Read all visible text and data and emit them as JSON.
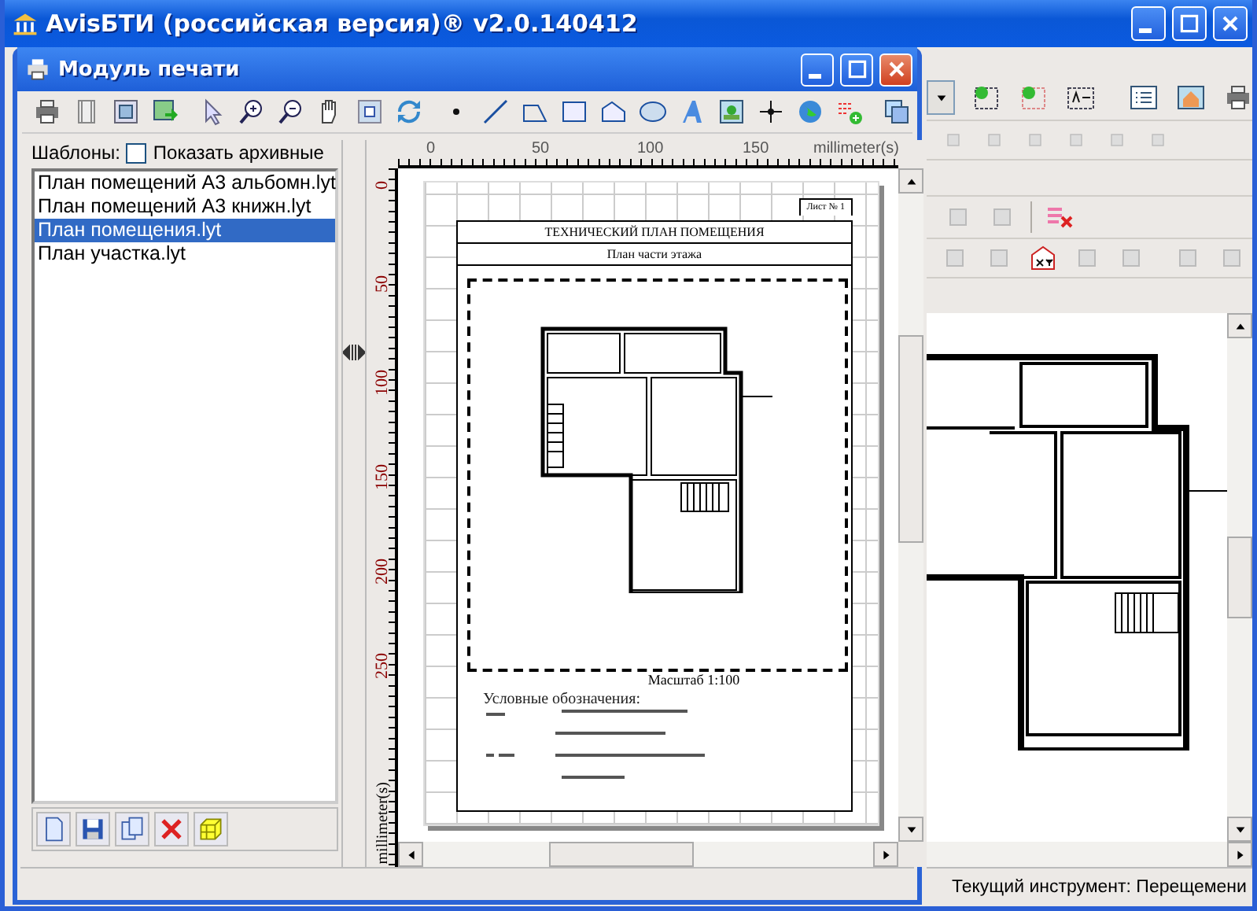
{
  "main_window": {
    "title": "AvisБТИ (российская версия)® v2.0.140412",
    "status_text": "Текущий инструмент: Перещемени"
  },
  "print_window": {
    "title": "Модуль печати",
    "templates_label": "Шаблоны:",
    "show_archived": {
      "label": "Показать архивные",
      "checked": false
    },
    "templates": [
      {
        "name": "План помещений А3 альбомн.lyt",
        "selected": false
      },
      {
        "name": "План помещений А3 книжн.lyt",
        "selected": false
      },
      {
        "name": "План помещения.lyt",
        "selected": true
      },
      {
        "name": "План участка.lyt",
        "selected": false
      }
    ],
    "preview": {
      "top_ruler": {
        "ticks": [
          "0",
          "50",
          "100",
          "150"
        ],
        "unit": "millimeter(s)"
      },
      "left_ruler": {
        "ticks": [
          "0",
          "50",
          "100",
          "150",
          "200",
          "250"
        ],
        "unit": "millimeter(s)"
      },
      "page": {
        "sheet_label": "Лист № 1",
        "title": "ТЕХНИЧЕСКИЙ ПЛАН ПОМЕЩЕНИЯ",
        "subtitle": "План части этажа",
        "scale": "Масштаб 1:100",
        "legend_title": "Условные обозначения:"
      }
    }
  }
}
